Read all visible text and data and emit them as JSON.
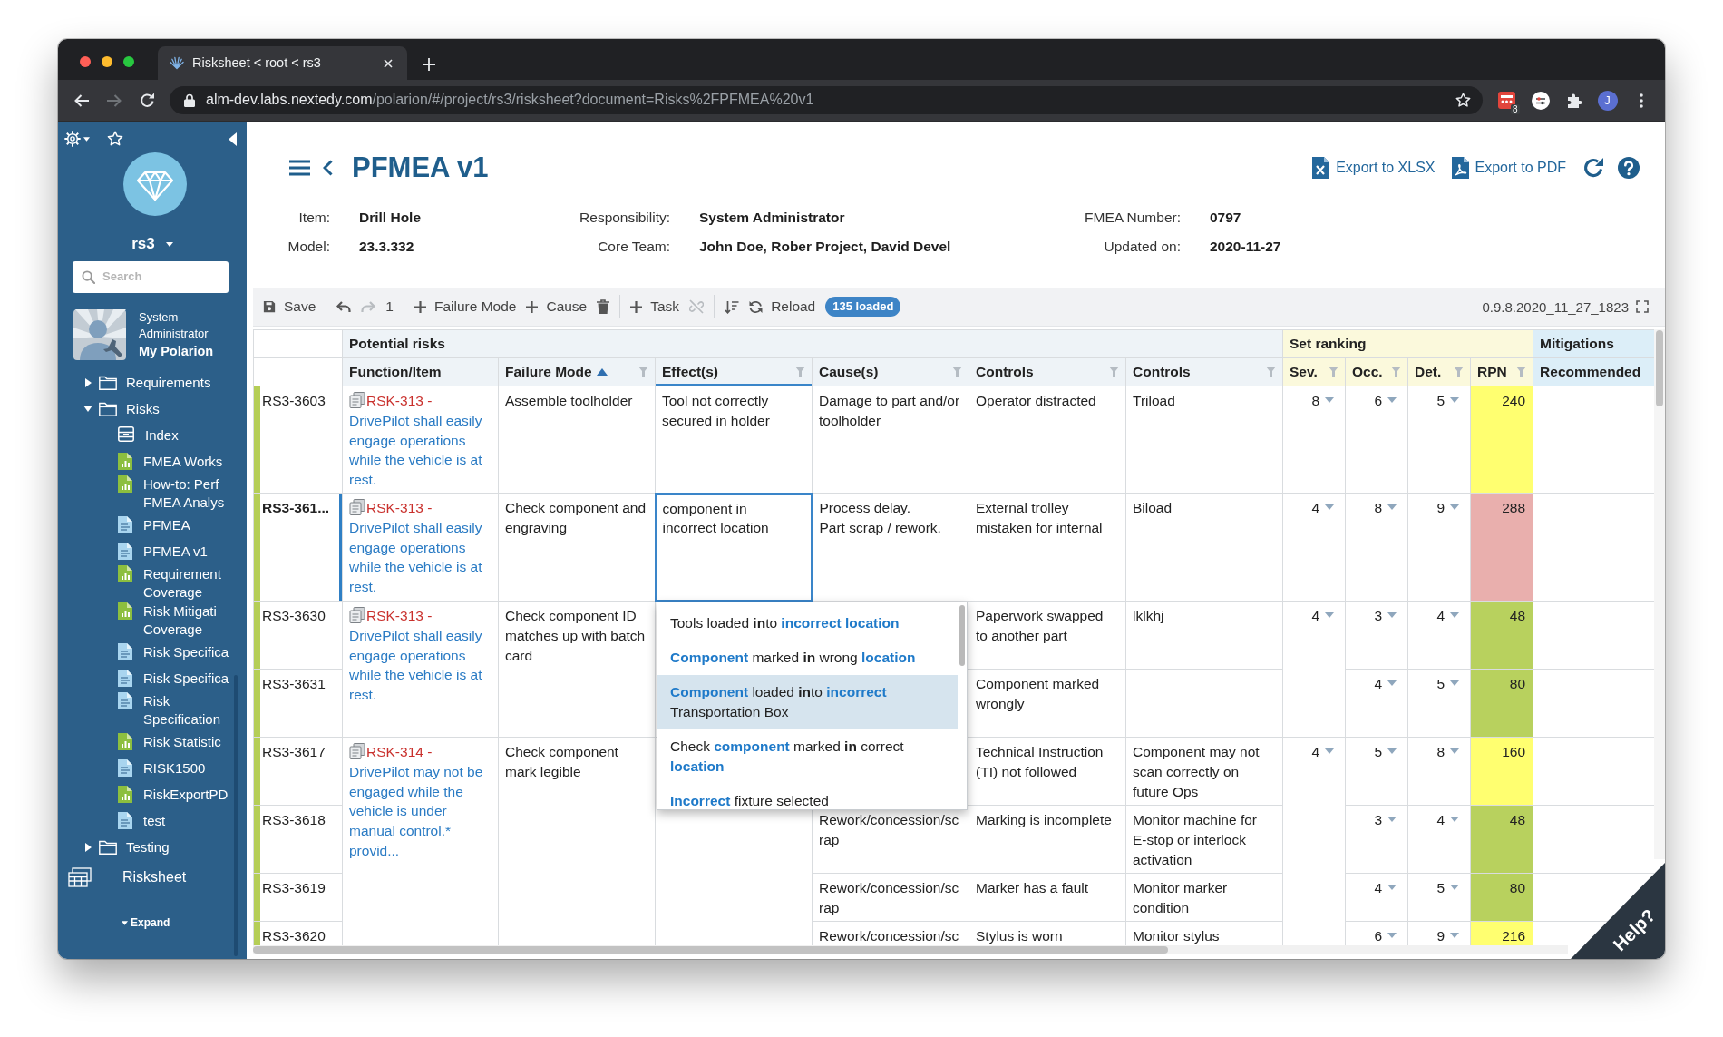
{
  "browser": {
    "tab_title": "Risksheet < root < rs3",
    "url_host": "alm-dev.labs.nextedy.com",
    "url_path": "/polarion/#/project/rs3/risksheet?document=Risks%2FPFMEA%20v1",
    "forward_disabled": true,
    "extension_badge": "8",
    "profile_initial": "J"
  },
  "sidebar": {
    "project": "rs3",
    "search": {
      "placeholder": "Search"
    },
    "user": {
      "name": "System Administrator",
      "link": "My Polarion"
    },
    "tree": [
      {
        "label": "Requirements",
        "kind": "folder",
        "expanded": false
      },
      {
        "label": "Risks",
        "kind": "folder",
        "expanded": true,
        "children": [
          {
            "label": "Index",
            "kind": "index"
          },
          {
            "label": "FMEA Works",
            "kind": "report"
          },
          {
            "label": "How-to: Perf FMEA Analys",
            "kind": "report"
          },
          {
            "label": "PFMEA",
            "kind": "document"
          },
          {
            "label": "PFMEA v1",
            "kind": "document"
          },
          {
            "label": "Requirement Coverage",
            "kind": "report"
          },
          {
            "label": "Risk Mitigati Coverage",
            "kind": "report"
          },
          {
            "label": "Risk Specifica",
            "kind": "document"
          },
          {
            "label": "Risk Specifica",
            "kind": "document"
          },
          {
            "label": "Risk Specification",
            "kind": "document"
          },
          {
            "label": "Risk Statistic",
            "kind": "report"
          },
          {
            "label": "RISK1500",
            "kind": "document"
          },
          {
            "label": "RiskExportPD",
            "kind": "report"
          },
          {
            "label": "test",
            "kind": "document"
          }
        ]
      },
      {
        "label": "Testing",
        "kind": "folder",
        "expanded": false
      }
    ],
    "shortcuts": [
      {
        "label": "Risksheet",
        "kind": "risksheet"
      }
    ],
    "expand_label": "Expand"
  },
  "header": {
    "title": "PFMEA v1",
    "actions": [
      {
        "label": "Export to XLSX",
        "kind": "xlsx"
      },
      {
        "label": "Export to PDF",
        "kind": "pdf"
      }
    ]
  },
  "info": [
    {
      "label": "Item:",
      "value": "Drill Hole"
    },
    {
      "label": "Responsibility:",
      "value": "System Administrator"
    },
    {
      "label": "FMEA Number:",
      "value": "0797"
    },
    {
      "label": "Model:",
      "value": "23.3.332"
    },
    {
      "label": "Core Team:",
      "value": "John Doe, Rober Project, David Devel"
    },
    {
      "label": "Updated on:",
      "value": "2020-11-27"
    }
  ],
  "toolbar": {
    "groups": [
      [
        {
          "kind": "save",
          "label": "Save",
          "disabled": false
        }
      ],
      [
        {
          "kind": "undo",
          "disabled": false
        },
        {
          "kind": "redo",
          "disabled": true
        },
        {
          "kind": "count",
          "label": "1",
          "disabled": false
        }
      ],
      [
        {
          "kind": "add",
          "label": "Failure Mode",
          "disabled": false
        },
        {
          "kind": "add",
          "label": "Cause",
          "disabled": false
        },
        {
          "kind": "delete",
          "disabled": false
        }
      ],
      [
        {
          "kind": "add",
          "label": "Task",
          "disabled": false
        },
        {
          "kind": "unlink",
          "disabled": true
        }
      ],
      [
        {
          "kind": "sort",
          "disabled": false
        },
        {
          "kind": "reload",
          "label": "Reload",
          "disabled": false
        },
        {
          "kind": "badge",
          "label": "135 loaded"
        }
      ]
    ],
    "version": "0.9.8.2020_11_27_1823"
  },
  "table": {
    "column_groups": [
      {
        "label": "Potential risks",
        "color": "#eef3f7",
        "columns": [
          {
            "label": "Function/Item",
            "filter": false,
            "sorted": false,
            "active": false
          },
          {
            "label": "Failure Mode",
            "filter": true,
            "sorted": true,
            "active": false
          },
          {
            "label": "Effect(s)",
            "filter": true,
            "sorted": false,
            "active": true
          },
          {
            "label": "Cause(s)",
            "filter": true,
            "sorted": false,
            "active": false
          },
          {
            "label": "Controls",
            "filter": true,
            "sorted": false,
            "active": false
          },
          {
            "label": "Controls",
            "filter": true,
            "sorted": false,
            "active": false
          }
        ]
      },
      {
        "label": "Set ranking",
        "color": "#fbf9dc",
        "columns": [
          {
            "label": "Sev.",
            "filter": true,
            "sorted": false,
            "active": false
          },
          {
            "label": "Occ.",
            "filter": true,
            "sorted": false,
            "active": false
          },
          {
            "label": "Det.",
            "filter": true,
            "sorted": false,
            "active": false
          },
          {
            "label": "RPN",
            "filter": true,
            "sorted": false,
            "active": false
          }
        ]
      },
      {
        "label": "Mitigations",
        "color": "#dceef8",
        "columns": [
          {
            "label": "Recommended",
            "filter": false,
            "sorted": false,
            "active": false
          }
        ]
      }
    ],
    "groups": [
      {
        "function": {
          "ref": "RSK-313 -",
          "title": "DrivePilot shall easily engage operations while the vehicle is at rest."
        },
        "failure_mode": "Assemble toolholder",
        "effect": {
          "text": "Tool not correctly secured in holder",
          "focused": false
        },
        "severity": "8",
        "rows": [
          {
            "id": "RS3-3603",
            "selected": false,
            "cause": "Damage to part and/or toolholder",
            "controls_1": "Operator distracted",
            "controls_2": "Triload",
            "occurrence": "6",
            "detection": "5",
            "rpn": {
              "value": "240",
              "color": "#ffff70"
            }
          }
        ]
      },
      {
        "function": {
          "ref": "RSK-313 -",
          "title": "DrivePilot shall easily engage operations while the vehicle is at rest."
        },
        "failure_mode": "Check component and engraving",
        "effect": {
          "text": "component in incorrect location",
          "focused": true,
          "suggestions": [
            {
              "selected": false,
              "parts": [
                {
                  "text": "Tools loaded ",
                  "kind": "plain"
                },
                {
                  "text": "in",
                  "kind": "bold"
                },
                {
                  "text": "to ",
                  "kind": "plain"
                },
                {
                  "text": "incorrect location",
                  "kind": "match"
                }
              ]
            },
            {
              "selected": false,
              "parts": [
                {
                  "text": "Component",
                  "kind": "match"
                },
                {
                  "text": " marked ",
                  "kind": "plain"
                },
                {
                  "text": "in",
                  "kind": "bold"
                },
                {
                  "text": " wrong ",
                  "kind": "plain"
                },
                {
                  "text": "location",
                  "kind": "match"
                }
              ]
            },
            {
              "selected": true,
              "parts": [
                {
                  "text": "Component",
                  "kind": "match"
                },
                {
                  "text": " loaded ",
                  "kind": "plain"
                },
                {
                  "text": "in",
                  "kind": "bold"
                },
                {
                  "text": "to ",
                  "kind": "plain"
                },
                {
                  "text": "incorrect",
                  "kind": "match"
                },
                {
                  "text": " Transportation Box",
                  "kind": "plain"
                }
              ]
            },
            {
              "selected": false,
              "parts": [
                {
                  "text": "Check ",
                  "kind": "plain"
                },
                {
                  "text": "component",
                  "kind": "match"
                },
                {
                  "text": " marked ",
                  "kind": "plain"
                },
                {
                  "text": "in",
                  "kind": "bold"
                },
                {
                  "text": " correct ",
                  "kind": "plain"
                },
                {
                  "text": "location",
                  "kind": "match"
                }
              ]
            },
            {
              "selected": false,
              "parts": [
                {
                  "text": "Incorrect",
                  "kind": "match"
                },
                {
                  "text": " fixture selected",
                  "kind": "plain"
                }
              ]
            }
          ]
        },
        "severity": "4",
        "rows": [
          {
            "id": "RS3-361...",
            "selected": true,
            "cause": "Process delay.\nPart scrap / rework.",
            "controls_1": "External trolley mistaken for internal",
            "controls_2": "Biload",
            "occurrence": "8",
            "detection": "9",
            "rpn": {
              "value": "288",
              "color": "#e9afad"
            }
          }
        ]
      },
      {
        "function": {
          "ref": "RSK-313 -",
          "title": "DrivePilot shall easily engage operations while the vehicle is at rest."
        },
        "failure_mode": "Check component ID matches up with batch card",
        "severity": "4",
        "rows": [
          {
            "id": "RS3-3630",
            "selected": false,
            "controls_1": "Paperwork swapped to another part",
            "controls_2": "lklkhj",
            "occurrence": "3",
            "detection": "4",
            "rpn": {
              "value": "48",
              "color": "#b8d15e"
            }
          },
          {
            "id": "RS3-3631",
            "selected": false,
            "controls_1": "Component marked wrongly",
            "occurrence": "4",
            "detection": "5",
            "rpn": {
              "value": "80",
              "color": "#b8d15e"
            }
          }
        ]
      },
      {
        "function": {
          "ref": "RSK-314 -",
          "title": "DrivePilot may not be engaged while the vehicle is under manual control.* provid..."
        },
        "failure_mode": "Check component mark legible",
        "severity": "4",
        "rows": [
          {
            "id": "RS3-3617",
            "selected": false,
            "controls_1": "Technical Instruction (TI) not followed",
            "controls_2": "Component may not scan correctly on future Ops",
            "occurrence": "5",
            "detection": "8",
            "rpn": {
              "value": "160",
              "color": "#ffff70"
            }
          },
          {
            "id": "RS3-3618",
            "selected": false,
            "cause": "Rework/concession/scrap",
            "controls_1": "Marking is incomplete",
            "controls_2": "Monitor machine for E-stop or interlock activation",
            "occurrence": "3",
            "detection": "4",
            "rpn": {
              "value": "48",
              "color": "#b8d15e"
            }
          },
          {
            "id": "RS3-3619",
            "selected": false,
            "cause": "Rework/concession/scrap",
            "controls_1": "Marker has a fault",
            "controls_2": "Monitor marker condition",
            "occurrence": "4",
            "detection": "5",
            "rpn": {
              "value": "80",
              "color": "#b8d15e"
            }
          },
          {
            "id": "RS3-3620",
            "selected": false,
            "cause": "Rework/concession/sc",
            "controls_1": "Stylus is worn",
            "controls_2": "Monitor stylus",
            "occurrence": "6",
            "detection": "9",
            "rpn": {
              "value": "216",
              "color": "#ffff70"
            }
          }
        ]
      }
    ]
  },
  "help_tab": "Help?"
}
